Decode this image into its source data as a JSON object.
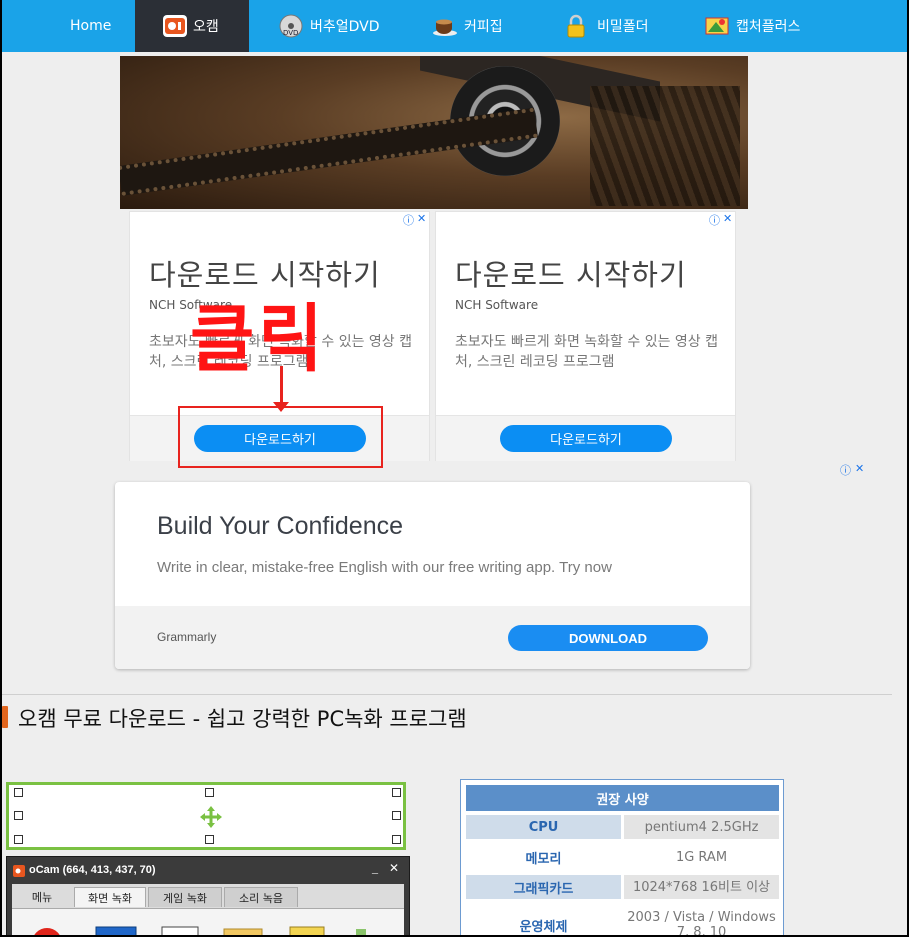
{
  "nav": {
    "items": [
      {
        "label": "Home",
        "icon": "home"
      },
      {
        "label": "오캠",
        "icon": "ocam-logo-icon"
      },
      {
        "label": "버추얼DVD",
        "icon": "dvd-disc-icon"
      },
      {
        "label": "커피집",
        "icon": "coffee-cup-icon"
      },
      {
        "label": "비밀폴더",
        "icon": "padlock-icon"
      },
      {
        "label": "캡처플러스",
        "icon": "capture-plus-icon"
      }
    ],
    "active_index": 1,
    "bg_color": "#1aa3e8",
    "active_color": "#2b2f36"
  },
  "ads": {
    "cards": [
      {
        "title": "다운로드 시작하기",
        "brand": "NCH Software",
        "desc": "초보자도 빠르게 화면 녹화할 수 있는 영상 캡처, 스크린 레코딩 프로그램",
        "button": "다운로드하기"
      },
      {
        "title": "다운로드 시작하기",
        "brand": "NCH Software",
        "desc": "초보자도 빠르게 화면 녹화할 수 있는 영상 캡처, 스크린 레코딩 프로그램",
        "button": "다운로드하기"
      }
    ],
    "annotation": {
      "text": "클릭",
      "color": "#ff1414"
    },
    "info_icon": "ⓘ",
    "close_icon": "✕"
  },
  "grammarly": {
    "title": "Build Your Confidence",
    "desc": "Write in clear, mistake-free English with our free writing app. Try now",
    "brand": "Grammarly",
    "button": "DOWNLOAD"
  },
  "post": {
    "title": "오캠 무료 다운로드 - 쉽고 강력한 PC녹화 프로그램"
  },
  "ocam": {
    "window_title": "oCam (664, 413, 437, 70)",
    "minimize": "_",
    "close": "✕",
    "tabs": [
      "메뉴",
      "화면 녹화",
      "게임 녹화",
      "소리 녹음"
    ],
    "active_tab": 1
  },
  "spec": {
    "header": "권장 사양",
    "rows": [
      {
        "key": "CPU",
        "value": "pentium4 2.5GHz"
      },
      {
        "key": "메모리",
        "value": "1G RAM"
      },
      {
        "key": "그래픽카드",
        "value": "1024*768 16비트 이상"
      },
      {
        "key": "운영체제",
        "value": "2003 / Vista / Windows 7, 8, 10"
      }
    ]
  }
}
